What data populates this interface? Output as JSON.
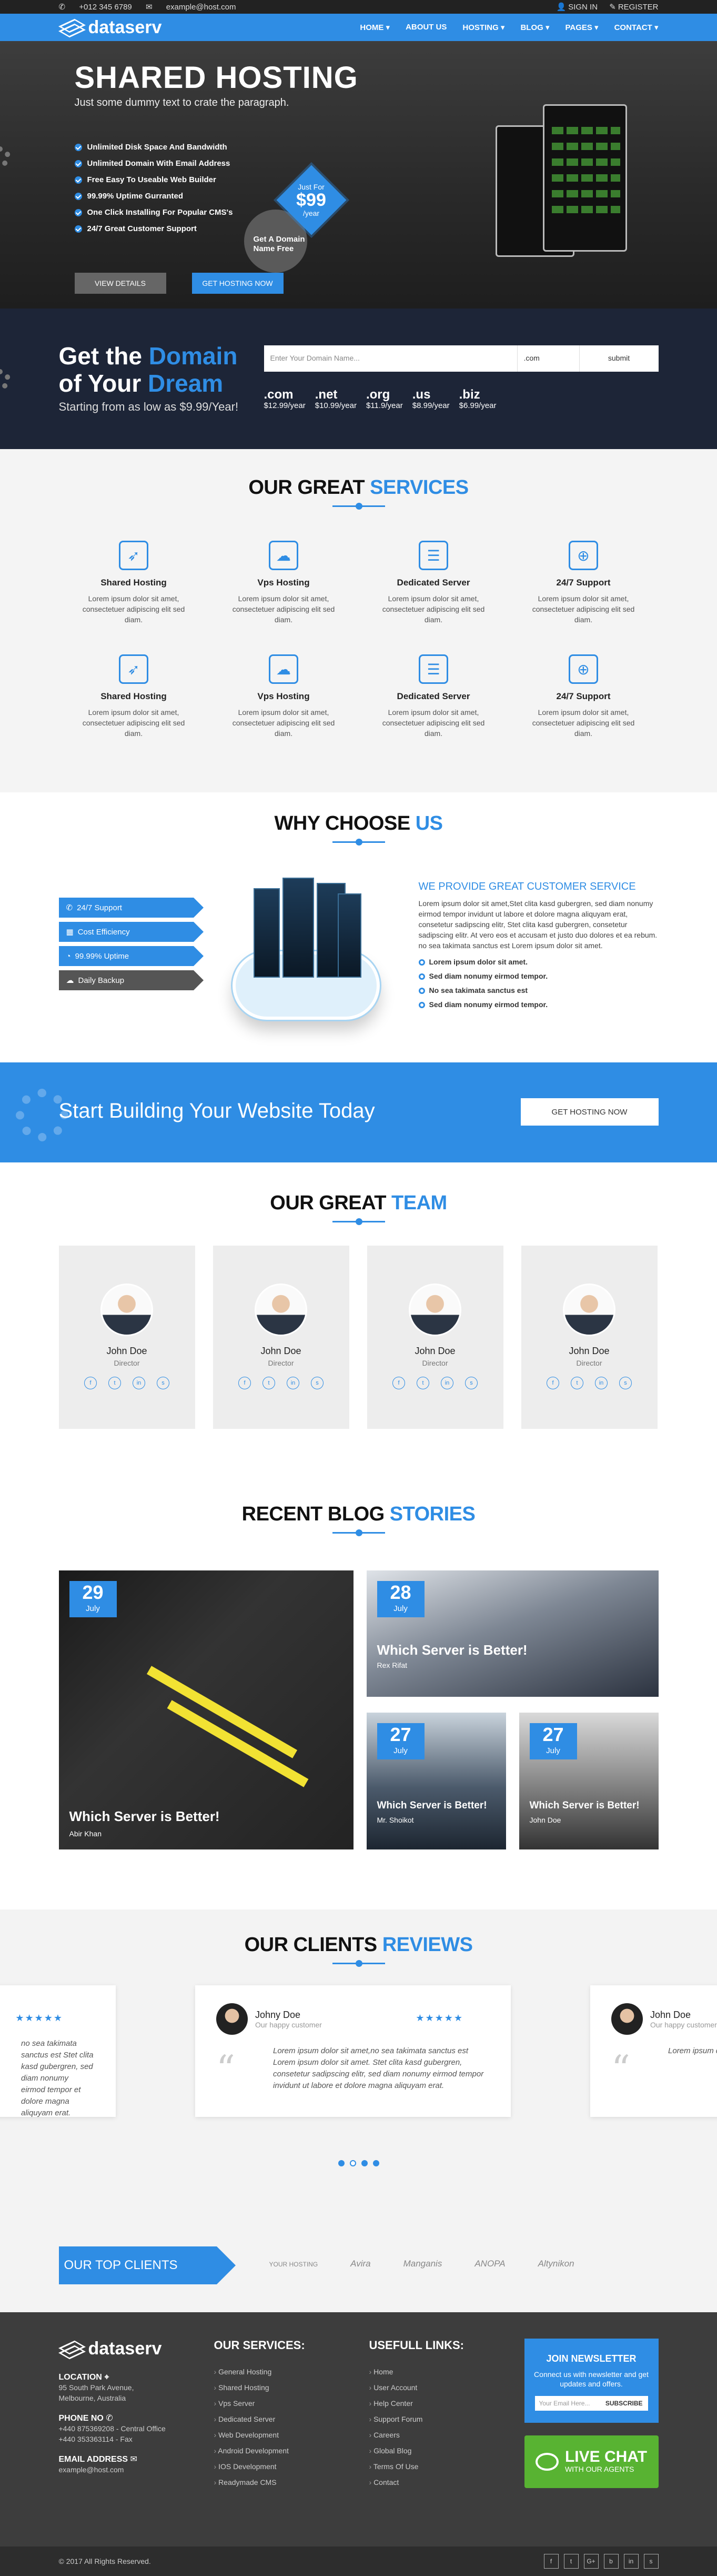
{
  "topbar": {
    "phone": "+012 345 6789",
    "email": "example@host.com",
    "signin": "SIGN IN",
    "register": "REGISTER"
  },
  "nav": {
    "brand": "dataserv",
    "items": [
      "HOME ▾",
      "ABOUT US",
      "HOSTING ▾",
      "BLOG ▾",
      "PAGES ▾",
      "CONTACT ▾"
    ]
  },
  "hero": {
    "title": "SHARED HOSTING",
    "subtitle": "Just some dummy text to crate the paragraph.",
    "features": [
      "Unlimited Disk Space And Bandwidth",
      "Unlimited Domain With Email Address",
      "Free Easy To Useable Web Builder",
      "99.99% Uptime Gurranted",
      "One Click Installing For Popular CMS's",
      "24/7 Great Customer Support"
    ],
    "badge_grey": "Get A Domain Name Free",
    "badge_top": "Just For",
    "badge_price": "$99",
    "badge_bottom": "/year",
    "btn_details": "VIEW DETAILS",
    "btn_hosting": "GET HOSTING NOW"
  },
  "domain": {
    "title_a": "Get the ",
    "title_b": "Domain",
    "title_c": "of Your ",
    "title_d": "Dream",
    "starting": "Starting from as low as $9.99/Year!",
    "placeholder": "Enter Your Domain Name...",
    "select": ".com",
    "submit": "submit",
    "tlds": [
      {
        "ext": ".com",
        "price": "$12.99/year"
      },
      {
        "ext": ".net",
        "price": "$10.99/year"
      },
      {
        "ext": ".org",
        "price": "$11.9/year"
      },
      {
        "ext": ".us",
        "price": "$8.99/year"
      },
      {
        "ext": ".biz",
        "price": "$6.99/year"
      }
    ]
  },
  "services": {
    "title_a": "OUR GREAT ",
    "title_b": "SERVICES",
    "items": [
      {
        "icon": "rocket-icon",
        "glyph": "➶",
        "name": "Shared Hosting",
        "text": "Lorem ipsum dolor sit amet, consectetuer adipiscing elit sed diam."
      },
      {
        "icon": "cloud-servers-icon",
        "glyph": "☁",
        "name": "Vps Hosting",
        "text": "Lorem ipsum dolor sit amet, consectetuer adipiscing elit sed diam."
      },
      {
        "icon": "server-icon",
        "glyph": "☰",
        "name": "Dedicated Server",
        "text": "Lorem ipsum dolor sit amet, consectetuer adipiscing elit sed diam."
      },
      {
        "icon": "lifebuoy-icon",
        "glyph": "⊕",
        "name": "24/7 Support",
        "text": "Lorem ipsum dolor sit amet, consectetuer adipiscing elit sed diam."
      },
      {
        "icon": "rocket-icon",
        "glyph": "➶",
        "name": "Shared Hosting",
        "text": "Lorem ipsum dolor sit amet, consectetuer adipiscing elit sed diam."
      },
      {
        "icon": "cloud-servers-icon",
        "glyph": "☁",
        "name": "Vps Hosting",
        "text": "Lorem ipsum dolor sit amet, consectetuer adipiscing elit sed diam."
      },
      {
        "icon": "server-icon",
        "glyph": "☰",
        "name": "Dedicated Server",
        "text": "Lorem ipsum dolor sit amet, consectetuer adipiscing elit sed diam."
      },
      {
        "icon": "lifebuoy-icon",
        "glyph": "⊕",
        "name": "24/7 Support",
        "text": "Lorem ipsum dolor sit amet, consectetuer adipiscing elit sed diam."
      }
    ]
  },
  "why": {
    "title_a": "WHY CHOOSE ",
    "title_b": "US",
    "tabs": [
      "24/7 Support",
      "Cost Efficiency",
      "99.99% Uptime",
      "Daily Backup"
    ],
    "heading": "WE PROVIDE GREAT CUSTOMER SERVICE",
    "para1": "Lorem ipsum dolor sit amet,Stet clita kasd gubergren, sed diam nonumy eirmod tempor invidunt ut labore et dolore magna aliquyam erat, consetetur sadipscing elitr, Stet clita kasd gubergren, consetetur sadipscing elitr. At vero eos et accusam et justo duo dolores et ea rebum. no sea takimata sanctus est Lorem ipsum dolor sit amet.",
    "bullets": [
      "Lorem ipsum dolor sit amet.",
      "Sed diam nonumy eirmod tempor.",
      "No sea takimata sanctus est",
      "Sed diam nonumy eirmod tempor."
    ]
  },
  "cta": {
    "text": "Start Building Your Website Today",
    "button": "GET HOSTING NOW"
  },
  "team": {
    "title_a": "OUR GREAT ",
    "title_b": "TEAM",
    "members": [
      {
        "name": "John Doe",
        "role": "Director"
      },
      {
        "name": "John Doe",
        "role": "Director"
      },
      {
        "name": "John Doe",
        "role": "Director"
      },
      {
        "name": "John Doe",
        "role": "Director"
      }
    ],
    "social_glyphs": [
      "f",
      "t",
      "in",
      "s"
    ]
  },
  "blog": {
    "title_a": "RECENT BLOG ",
    "title_b": "STORIES",
    "posts": [
      {
        "day": "29",
        "month": "July",
        "title": "Which Server is Better!",
        "author": "Abir Khan"
      },
      {
        "day": "28",
        "month": "July",
        "title": "Which Server is Better!",
        "author": "Rex Rifat"
      },
      {
        "day": "27",
        "month": "July",
        "title": "Which Server is Better!",
        "author": "Mr. Shoikot"
      },
      {
        "day": "27",
        "month": "July",
        "title": "Which Server is Better!",
        "author": "John Doe"
      }
    ]
  },
  "reviews": {
    "title_a": "OUR CLIENTS ",
    "title_b": "REVIEWS",
    "left_text": "no sea takimata sanctus est Stet clita kasd gubergren, sed diam nonumy eirmod tempor et dolore magna aliquyam erat.",
    "center": {
      "name": "Johny Doe",
      "tag": "Our happy customer",
      "stars": "★★★★★",
      "text": "Lorem ipsum dolor sit amet,no sea takimata sanctus est Lorem ipsum dolor sit amet. Stet clita kasd gubergren, consetetur sadipscing elitr, sed diam nonumy eirmod tempor invidunt ut labore et dolore magna aliquyam erat."
    },
    "right": {
      "name": "John Doe",
      "tag": "Our happy customer",
      "text": "Lorem ipsum dolor sit amet, consetetur sadipscing elitr"
    },
    "left_stars": "★★★★★"
  },
  "clients": {
    "label": "OUR TOP CLIENTS",
    "logos": [
      "YOUR HOSTING",
      "Avira",
      "Manganis",
      "ANOPA",
      "Altynikon"
    ]
  },
  "footer": {
    "brand": "dataserv",
    "location_label": "LOCATION",
    "location": "95 South Park Avenue, Melbourne, Australia",
    "phone_label": "PHONE NO",
    "phone1": "+440 875369208 - Central Office",
    "phone2": "+440 353363114 - Fax",
    "email_label": "EMAIL ADDRESS",
    "email": "example@host.com",
    "services_head": "OUR SERVICES:",
    "services": [
      "General Hosting",
      "Shared Hosting",
      "Vps Server",
      "Dedicated Server",
      "Web Development",
      "Android Development",
      "IOS Development",
      "Readymade CMS"
    ],
    "links_head": "USEFULL LINKS:",
    "links": [
      "Home",
      "User Account",
      "Help Center",
      "Support Forum",
      "Careers",
      "Global Blog",
      "Terms Of Use",
      "Contact"
    ],
    "news_head": "JOIN NEWSLETTER",
    "news_text": "Connect us with newsletter and get updates and offers.",
    "news_placeholder": "Your Email Here...",
    "news_btn": "SUBSCRIBE",
    "chat_big": "LIVE CHAT",
    "chat_small": "WITH OUR AGENTS",
    "copyright": "© 2017 All Rights Reserved.",
    "social": [
      "f",
      "t",
      "G+",
      "b",
      "in",
      "s"
    ]
  }
}
